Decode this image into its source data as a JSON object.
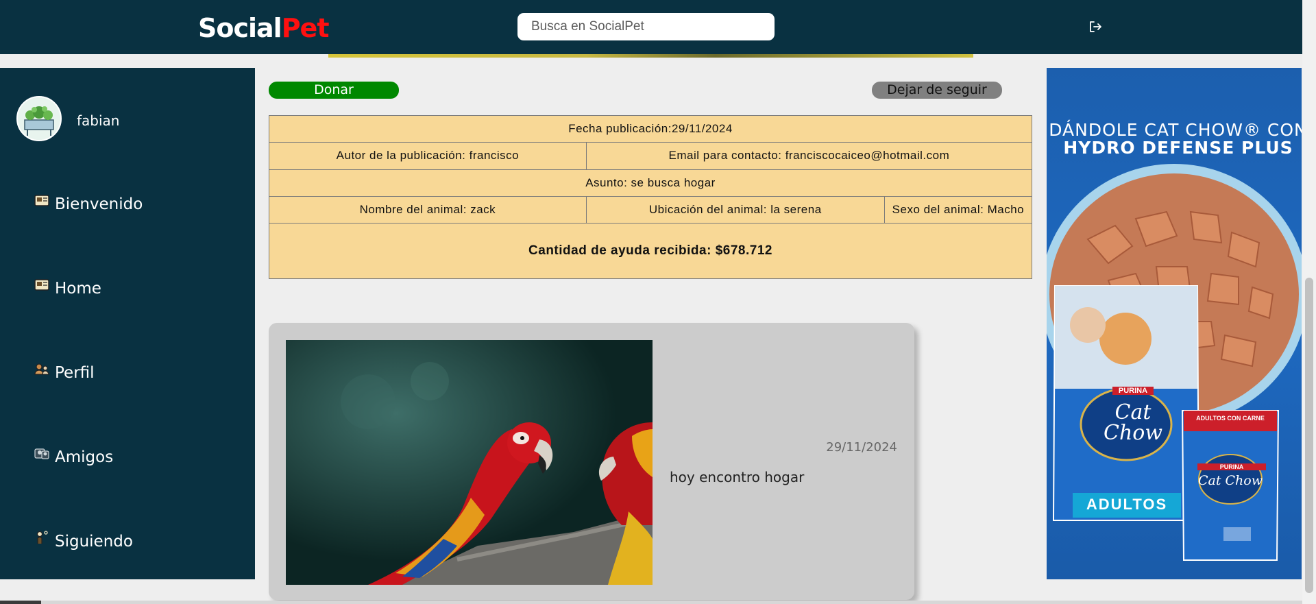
{
  "header": {
    "logo_part1": "Social",
    "logo_part2": "Pet",
    "search_placeholder": "Busca en SocialPet",
    "logout_icon": "logout-icon"
  },
  "sidebar": {
    "username": "fabian",
    "items": [
      {
        "label": "Bienvenido",
        "icon": "welcome-icon"
      },
      {
        "label": "Home",
        "icon": "home-icon"
      },
      {
        "label": "Perfil",
        "icon": "profile-icon"
      },
      {
        "label": "Amigos",
        "icon": "friends-icon"
      },
      {
        "label": "Siguiendo",
        "icon": "following-icon"
      }
    ]
  },
  "actions": {
    "donate_label": "Donar",
    "unfollow_label": "Dejar de seguir"
  },
  "publication": {
    "fecha": "Fecha publicación:29/11/2024",
    "autor": "Autor de la publicación: francisco",
    "email": "Email para contacto: franciscocaiceo@hotmail.com",
    "asunto": "Asunto: se busca hogar",
    "nombre": "Nombre del animal: zack",
    "ubicacion": "Ubicación del animal: la serena",
    "sexo": "Sexo del animal: Macho",
    "total": "Cantidad de ayuda recibida: $678.712"
  },
  "post": {
    "date": "29/11/2024",
    "text": "hoy encontro hogar"
  },
  "ad": {
    "line1": "DÁNDOLE CAT CHOW® CON",
    "line2": "HYDRO DEFENSE PLUS",
    "brand": "PURINA",
    "product": "Cat Chow",
    "adultos": "ADULTOS",
    "pouch_label": "ADULTOS CON CARNE"
  },
  "colors": {
    "header_bg": "#093141",
    "logo_accent": "#ff1010",
    "donate": "#008800",
    "unfollow": "#808080",
    "table_bg": "#f8d896"
  }
}
